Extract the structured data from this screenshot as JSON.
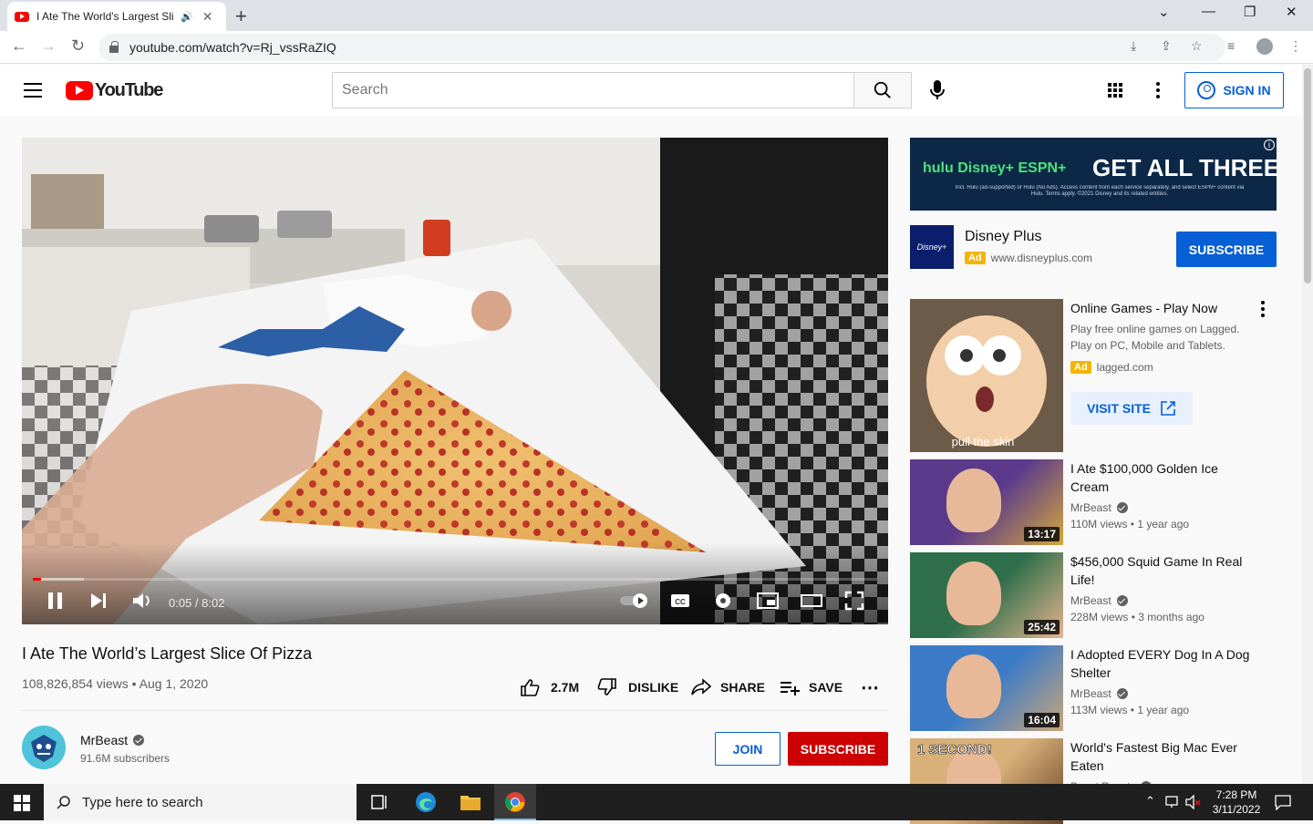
{
  "browser": {
    "tab_title": "I Ate The World's Largest Sli",
    "url": "youtube.com/watch?v=Rj_vssRaZIQ"
  },
  "header": {
    "logo_text": "YouTube",
    "search_placeholder": "Search",
    "signin_label": "SIGN IN"
  },
  "player": {
    "time": "0:05 / 8:02",
    "progress": 0.01,
    "buffered": 0.06
  },
  "video": {
    "title": "I Ate The World’s Largest Slice Of Pizza",
    "meta": "108,826,854 views • Aug 1, 2020",
    "likes": "2.7M",
    "dislike_label": "DISLIKE",
    "share_label": "SHARE",
    "save_label": "SAVE"
  },
  "channel": {
    "name": "MrBeast",
    "subscribers": "91.6M subscribers",
    "join_label": "JOIN",
    "subscribe_label": "SUBSCRIBE"
  },
  "ad": {
    "banner_headline": "GET ALL THREE",
    "banner_brands": "hulu  Disney+  ESPN+",
    "banner_fineprint": "Incl. Hulu (ad-supported) or Hulu (No Ads). Access content from each service separately, and select ESPN+ content via Hulu. Terms apply. ©2021 Disney and its related entities.",
    "promo_name": "Disney Plus",
    "promo_badge": "Ad",
    "promo_url": "www.disneyplus.com",
    "promo_subscribe": "SUBSCRIBE"
  },
  "sidebar": {
    "sponsored": {
      "title": "Online Games - Play Now",
      "desc": "Play free online games on Lagged. Play on PC, Mobile and Tablets.",
      "badge": "Ad",
      "domain": "lagged.com",
      "cta": "VISIT SITE",
      "thumb_caption": "pull the skin"
    },
    "recommendations": [
      {
        "title": "I Ate $100,000 Golden Ice Cream",
        "channel": "MrBeast",
        "stats": "110M views • 1 year ago",
        "duration": "13:17",
        "colors": [
          "#5b3a8c",
          "#d4a83c"
        ]
      },
      {
        "title": "$456,000 Squid Game In Real Life!",
        "channel": "MrBeast",
        "stats": "228M views • 3 months ago",
        "duration": "25:42",
        "colors": [
          "#2f6e4a",
          "#e7b48f"
        ]
      },
      {
        "title": "I Adopted EVERY Dog In A Dog Shelter",
        "channel": "MrBeast",
        "stats": "113M views • 1 year ago",
        "duration": "16:04",
        "colors": [
          "#3b7bc7",
          "#c9a57a"
        ]
      },
      {
        "title": "World's Fastest Big Mac Ever Eaten",
        "channel": "Beast Reacts",
        "stats": "",
        "duration": "",
        "badge": "1 SECOND!",
        "colors": [
          "#d9b07a",
          "#6a4528"
        ]
      }
    ]
  },
  "taskbar": {
    "search_placeholder": "Type here to search",
    "time": "7:28 PM",
    "date": "3/11/2022"
  }
}
